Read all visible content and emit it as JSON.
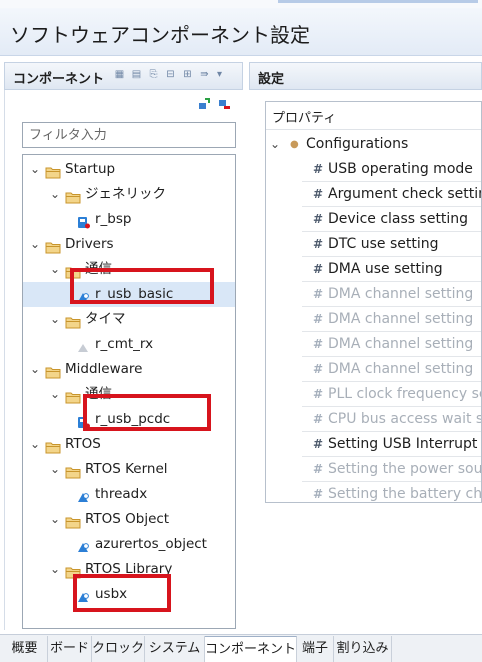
{
  "window": {
    "title": "ソフトウェアコンポーネント設定"
  },
  "left_panel": {
    "title": "コンポーネント",
    "filter_placeholder": "フィルタ入力",
    "tree": [
      {
        "label": "Startup",
        "type": "folder",
        "expanded": true
      },
      {
        "label": "ジェネリック",
        "type": "folder",
        "expanded": true
      },
      {
        "label": "r_bsp",
        "type": "component"
      },
      {
        "label": "Drivers",
        "type": "folder",
        "expanded": true
      },
      {
        "label": "通信",
        "type": "folder",
        "expanded": true
      },
      {
        "label": "r_usb_basic",
        "type": "component",
        "selected": true,
        "highlighted": true
      },
      {
        "label": "タイマ",
        "type": "folder",
        "expanded": true
      },
      {
        "label": "r_cmt_rx",
        "type": "component"
      },
      {
        "label": "Middleware",
        "type": "folder",
        "expanded": true
      },
      {
        "label": "通信",
        "type": "folder",
        "expanded": true
      },
      {
        "label": "r_usb_pcdc",
        "type": "component",
        "highlighted": true
      },
      {
        "label": "RTOS",
        "type": "folder",
        "expanded": true
      },
      {
        "label": "RTOS Kernel",
        "type": "folder",
        "expanded": true
      },
      {
        "label": "threadx",
        "type": "component"
      },
      {
        "label": "RTOS Object",
        "type": "folder",
        "expanded": true
      },
      {
        "label": "azurertos_object",
        "type": "component"
      },
      {
        "label": "RTOS Library",
        "type": "folder",
        "expanded": true
      },
      {
        "label": "usbx",
        "type": "component",
        "highlighted": true
      }
    ]
  },
  "right_panel": {
    "title": "設定",
    "property_header": "プロパティ",
    "group_label": "Configurations",
    "properties": [
      {
        "label": "USB operating mode",
        "enabled": true
      },
      {
        "label": "Argument check settin",
        "enabled": true
      },
      {
        "label": "Device class setting",
        "enabled": true
      },
      {
        "label": "DTC use setting",
        "enabled": true
      },
      {
        "label": "DMA use setting",
        "enabled": true
      },
      {
        "label": "DMA channel setting",
        "enabled": false
      },
      {
        "label": "DMA channel setting",
        "enabled": false
      },
      {
        "label": "DMA channel setting",
        "enabled": false
      },
      {
        "label": "DMA channel setting",
        "enabled": false
      },
      {
        "label": "PLL clock frequency se",
        "enabled": false
      },
      {
        "label": "CPU bus access wait s",
        "enabled": false
      },
      {
        "label": "Setting USB Interrupt",
        "enabled": true
      },
      {
        "label": "Setting the power sou",
        "enabled": false
      },
      {
        "label": "Setting the battery cha",
        "enabled": false
      }
    ]
  },
  "bottom_tabs": [
    {
      "label": "概要"
    },
    {
      "label": "ボード"
    },
    {
      "label": "クロック"
    },
    {
      "label": "システム"
    },
    {
      "label": "コンポーネント",
      "active": true
    },
    {
      "label": "端子"
    },
    {
      "label": "割り込み"
    }
  ],
  "colors": {
    "highlight_box": "#d7141d",
    "selection": "#d9e7f7",
    "folder": "#e2b24a",
    "component": "#2c7fd6"
  },
  "icons": {
    "folder": "folder-icon",
    "component": "component-icon",
    "property": "hash-icon",
    "expand": "chevron-down-icon"
  }
}
